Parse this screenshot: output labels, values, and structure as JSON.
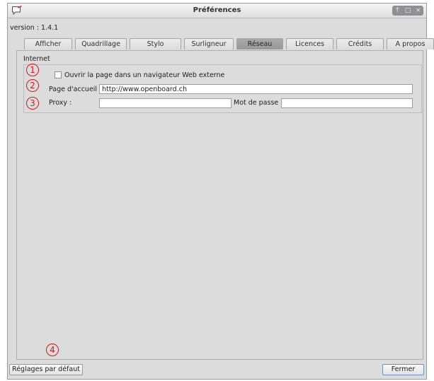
{
  "window": {
    "title": "Préférences"
  },
  "window_controls": [
    "↑",
    "□",
    "×"
  ],
  "version_label": "version : 1.4.1",
  "tabs": [
    {
      "label": "Afficher"
    },
    {
      "label": "Quadrillage"
    },
    {
      "label": "Stylo"
    },
    {
      "label": "Surligneur"
    },
    {
      "label": "Réseau",
      "active": true
    },
    {
      "label": "Licences"
    },
    {
      "label": "Crédits"
    },
    {
      "label": "A propos"
    }
  ],
  "internet": {
    "group_title": "Internet",
    "external_browser_label": "Ouvrir la page dans un navigateur Web externe",
    "external_browser_checked": false,
    "home_page_label": "Page d'accueil :",
    "home_page_value": "http://www.openboard.ch",
    "proxy_label": "Proxy :",
    "proxy_value": "",
    "password_label": "Mot de passe :",
    "password_value": ""
  },
  "markers": [
    "1",
    "2",
    "3",
    "4"
  ],
  "buttons": {
    "defaults": "Réglages par défaut",
    "close": "Fermer"
  },
  "colors": {
    "marker": "#d11a1a",
    "active_tab": "#9f9f9f",
    "window_bg": "#dcdcdc"
  }
}
